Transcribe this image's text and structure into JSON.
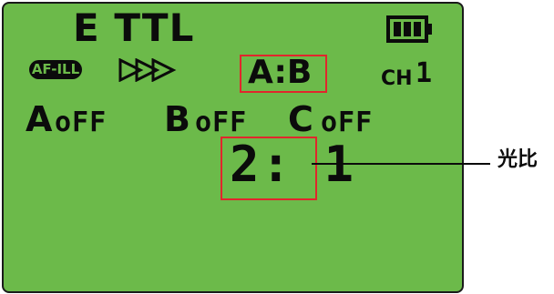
{
  "display": {
    "mode": "E TTL",
    "af_assist": "AF-ILL",
    "group_ratio_mode": "A:B",
    "channel_label": "CH",
    "channel_value": "1",
    "battery_level": "full"
  },
  "groups": [
    {
      "name": "A",
      "state": "oFF"
    },
    {
      "name": "B",
      "state": "oFF"
    },
    {
      "name": "C",
      "state": "oFF"
    }
  ],
  "ratio": {
    "value": "2: 1"
  },
  "callout": {
    "label": "光比"
  },
  "colors": {
    "lcd_background": "#6cba4a",
    "lcd_text": "#0b0b0b",
    "highlight_box": "#e1262c"
  },
  "icons": [
    "battery-icon",
    "high-speed-sync-arrows-icon"
  ]
}
